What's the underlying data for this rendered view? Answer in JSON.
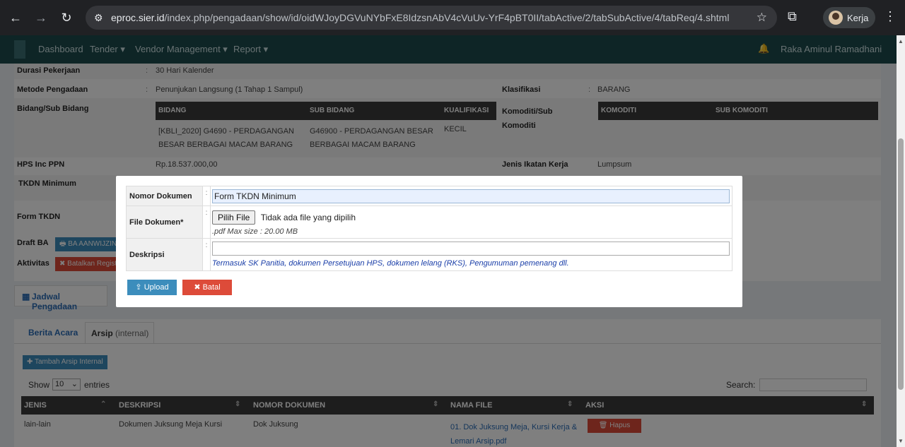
{
  "browser": {
    "url_host": "eproc.sier.id",
    "url_path": "/index.php/pengadaan/show/id/oidWJoyDGVuNYbFxE8IdzsnAbV4cVuUv-YrF4pBT0II/tabActive/2/tabSubActive/4/tabReq/4.shtml",
    "profile_name": "Kerja",
    "icons": [
      "back-icon",
      "forward-icon",
      "reload-icon",
      "site-settings-icon",
      "star-icon",
      "extensions-icon",
      "menu-icon"
    ]
  },
  "navbar": {
    "items": [
      "Dashboard",
      "Tender ▾",
      "Vendor Management ▾",
      "Report ▾"
    ],
    "user": "Raka Aminul Ramadhani"
  },
  "details": {
    "durasi_label": "Durasi Pekerjaan",
    "durasi_value": "30 Hari Kalender",
    "metode_label": "Metode Pengadaan",
    "metode_value": "Penunjukan Langsung (1 Tahap 1 Sampul)",
    "klasifikasi_label": "Klasifikasi",
    "klasifikasi_value": "BARANG",
    "bidang_label": "Bidang/Sub Bidang",
    "bidang_headers": [
      "BIDANG",
      "SUB BIDANG",
      "KUALIFIKASI"
    ],
    "bidang_row": [
      "[KBLI_2020] G4690 - PERDAGANGAN BESAR BERBAGAI MACAM BARANG",
      "G46900 - PERDAGANGAN BESAR BERBAGAI MACAM BARANG",
      "KECIL"
    ],
    "komoditi_label": "Komoditi/Sub Komoditi",
    "komoditi_headers": [
      "KOMODITI",
      "SUB KOMODITI"
    ],
    "hps_label": "HPS Inc PPN",
    "hps_value": "Rp.18.537.000,00",
    "ikatan_label": "Jenis Ikatan Kerja",
    "ikatan_value": "Lumpsum",
    "tkdn_min_label": "TKDN Minimum",
    "form_tkdn_label": "Form TKDN",
    "draft_ba_label": "Draft BA",
    "draft_ba_button": "BA AANWIJZING",
    "aktivitas_label": "Aktivitas",
    "batalkan_button": "Batalkan Registrasi",
    "jadwal_button": "Jadwal Pengadaan"
  },
  "lower": {
    "tab_berita": "Berita Acara",
    "tab_arsip": "Arsip",
    "tab_arsip_sub": "(internal)",
    "tambah_button": "Tambah Arsip Internal",
    "show_label": "Show",
    "show_value": "10",
    "entries_label": "entries",
    "search_label": "Search:",
    "columns": [
      "JENIS",
      "DESKRIPSI",
      "NOMOR DOKUMEN",
      "NAMA FILE",
      "AKSI"
    ],
    "row": {
      "jenis": "lain-lain",
      "deskripsi": "Dokumen Juksung Meja Kursi",
      "nomor": "Dok Juksung",
      "nama_file": "01. Dok Juksung Meja, Kursi Kerja & Lemari Arsip.pdf",
      "hapus": "Hapus"
    }
  },
  "modal": {
    "nomor_label": "Nomor Dokumen",
    "nomor_value": "Form TKDN Minimum",
    "file_label": "File Dokumen*",
    "file_button": "Pilih File",
    "file_status": "Tidak ada file yang dipilih",
    "file_help": ".pdf Max size : 20.00 MB",
    "deskripsi_label": "Deskripsi",
    "deskripsi_value": "",
    "deskripsi_help": "Termasuk SK Panitia, dokumen Persetujuan HPS, dokumen lelang (RKS), Pengumuman pemenang dll.",
    "upload_button": "Upload",
    "batal_button": "Batal"
  },
  "colors": {
    "navbar": "#1c4a4d",
    "upload": "#3c8dbc",
    "batal": "#dd4b39",
    "help_blue": "#1a3ea8"
  }
}
